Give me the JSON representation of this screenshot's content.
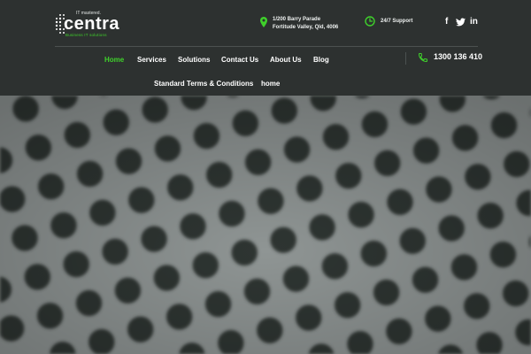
{
  "brand": {
    "tagline_top": "IT mastered.",
    "name": "centra",
    "tagline_bottom": "Business IT solutions"
  },
  "contact": {
    "address_line1": "1/200 Barry Parade",
    "address_line2": "Fortitude Valley, Qld, 4006",
    "support": "24/7 Support",
    "phone": "1300 136 410"
  },
  "social": {
    "facebook_glyph": "f",
    "twitter_glyph": "ὂ6",
    "linkedin_glyph": "in"
  },
  "nav": {
    "row1": [
      "Home",
      "Services",
      "Solutions",
      "Contact Us",
      "About Us",
      "Blog"
    ],
    "row2": [
      "Standard Terms & Conditions",
      "home"
    ]
  },
  "colors": {
    "header_bg": "#2d3130",
    "accent": "#3fd12b",
    "hero_bg": "#8f9594",
    "hero_dot": "#2f3433"
  },
  "icons": {
    "address": "map-pin-icon",
    "support": "clock-icon",
    "phone": "phone-icon",
    "facebook": "facebook-icon",
    "twitter": "twitter-icon",
    "linkedin": "linkedin-icon"
  }
}
